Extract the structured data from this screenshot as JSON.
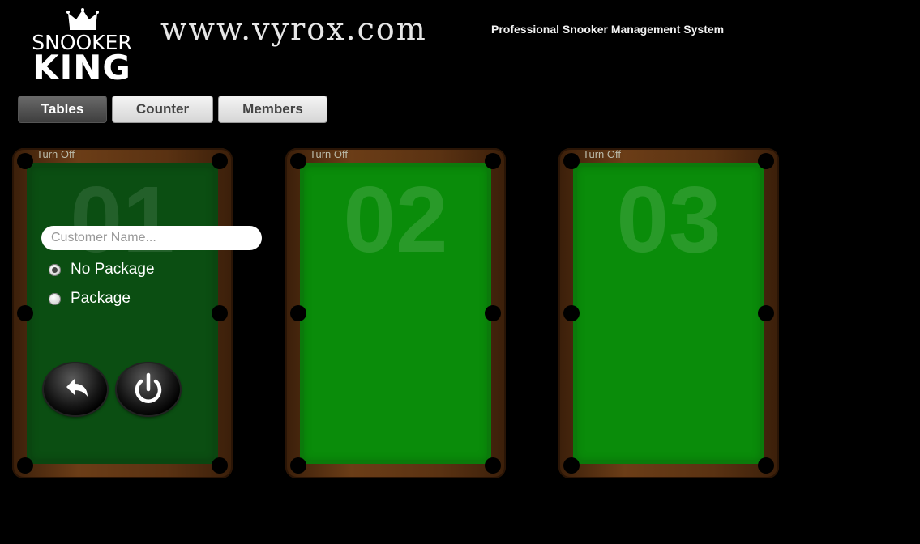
{
  "header": {
    "logo_top": "SNOOKER",
    "logo_bottom": "KING",
    "site_url": "www.vyrox.com",
    "tagline": "Professional Snooker Management System"
  },
  "nav": {
    "tabs": [
      {
        "label": "Tables",
        "active": true
      },
      {
        "label": "Counter",
        "active": false
      },
      {
        "label": "Members",
        "active": false
      }
    ]
  },
  "tables": [
    {
      "number": "01",
      "turn_off_label": "Turn Off",
      "active": true,
      "form": {
        "customer_placeholder": "Customer Name...",
        "customer_value": "",
        "options": [
          {
            "label": "No Package",
            "checked": true
          },
          {
            "label": "Package",
            "checked": false
          }
        ],
        "buttons": [
          "back-arrow-icon",
          "power-icon"
        ]
      }
    },
    {
      "number": "02",
      "turn_off_label": "Turn Off",
      "active": false
    },
    {
      "number": "03",
      "turn_off_label": "Turn Off",
      "active": false
    }
  ],
  "colors": {
    "background": "#000000",
    "felt": "#0a8c0a",
    "felt_active": "#0b4e12",
    "rail": "#6b3d17"
  }
}
